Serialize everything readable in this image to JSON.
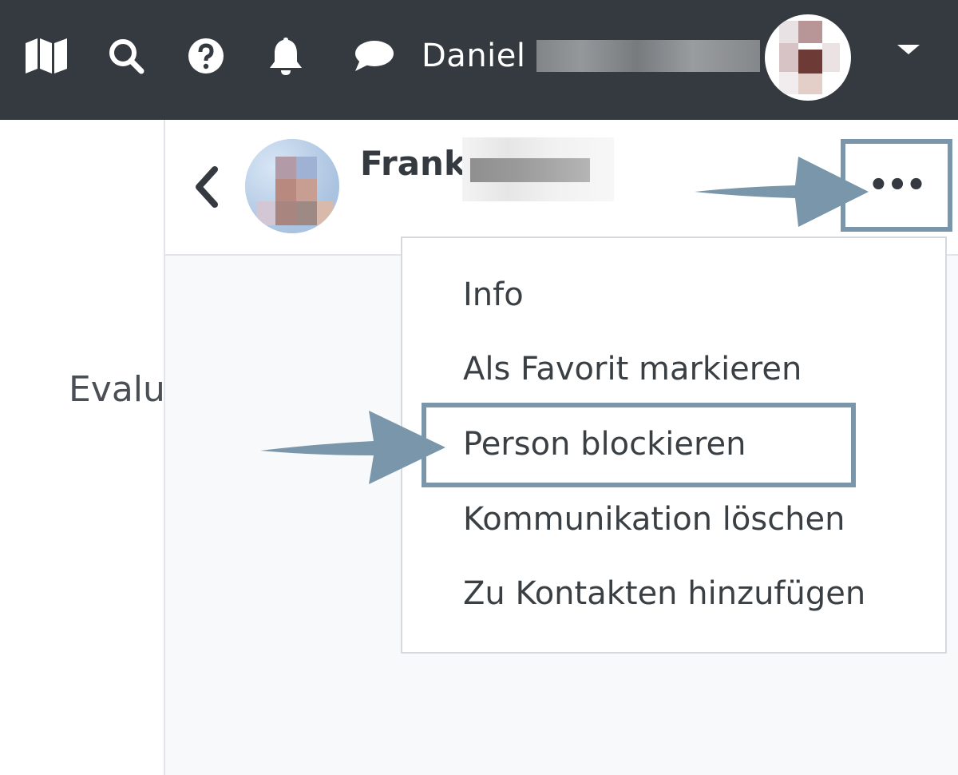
{
  "navbar": {
    "icons": [
      "map-icon",
      "search-icon",
      "help-icon",
      "bell-icon",
      "chat-icon",
      "chevron-down-icon"
    ],
    "username": "Daniel"
  },
  "sidebar": {
    "partial_label": "Evalu"
  },
  "conversation": {
    "back_icon": "chevron-left-icon",
    "contact_name": "Frank",
    "more_label": "•••"
  },
  "menu": {
    "items": [
      {
        "label": "Info"
      },
      {
        "label": "Als Favorit markieren"
      },
      {
        "label": "Person blockieren"
      },
      {
        "label": "Kommunikation löschen"
      },
      {
        "label": "Zu Kontakten hinzufügen"
      }
    ]
  },
  "colors": {
    "navbar": "#343a40",
    "annotation": "#7a96ab",
    "panel_bg": "#f8f9fa"
  }
}
